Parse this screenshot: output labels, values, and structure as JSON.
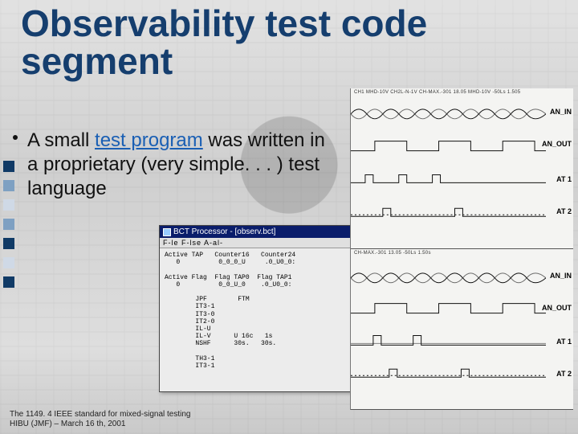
{
  "title": "Observability test code segment",
  "bullet": {
    "pre": "A small ",
    "link": "test program",
    "post": " was written in a proprietary (very simple. . . ) test language"
  },
  "footer": {
    "line1": "The 1149. 4 IEEE standard for mixed-signal testing",
    "line2": "HIBU (JMF) – March 16 th, 2001"
  },
  "bct": {
    "title": "BCT Processor - [observ.bct]",
    "menu": "F-le   F-lse   A-al-",
    "rows": [
      "Active TAP   Counter16   Counter24",
      "   0          0_0_0_U     .0_U0_0:",
      "",
      "Active Flag  Flag TAP0  Flag TAP1",
      "   0          0_0_U_0    .0_U0_0:",
      "",
      "        JPF        FTM",
      "        IT3-1",
      "        IT3-0",
      "        IT2-0",
      "        IL-U",
      "        IL-V      U 16c   1s",
      "        NSHF      30s.   30s.",
      "",
      "        TH3-1",
      "        IT3-1"
    ]
  },
  "scope": {
    "header_top": "CH1  MHD-10V   CH2L-N-1V         CH-MAX.-301  18.05\\n     MHD-10V                         -50Ls  1.505",
    "header_bot": "                                   CH-MAX.-301  13.05\\n                                      -50Ls  1.50s",
    "labels": [
      "AN_IN",
      "AN_OUT",
      "AT 1",
      "AT 2"
    ]
  }
}
